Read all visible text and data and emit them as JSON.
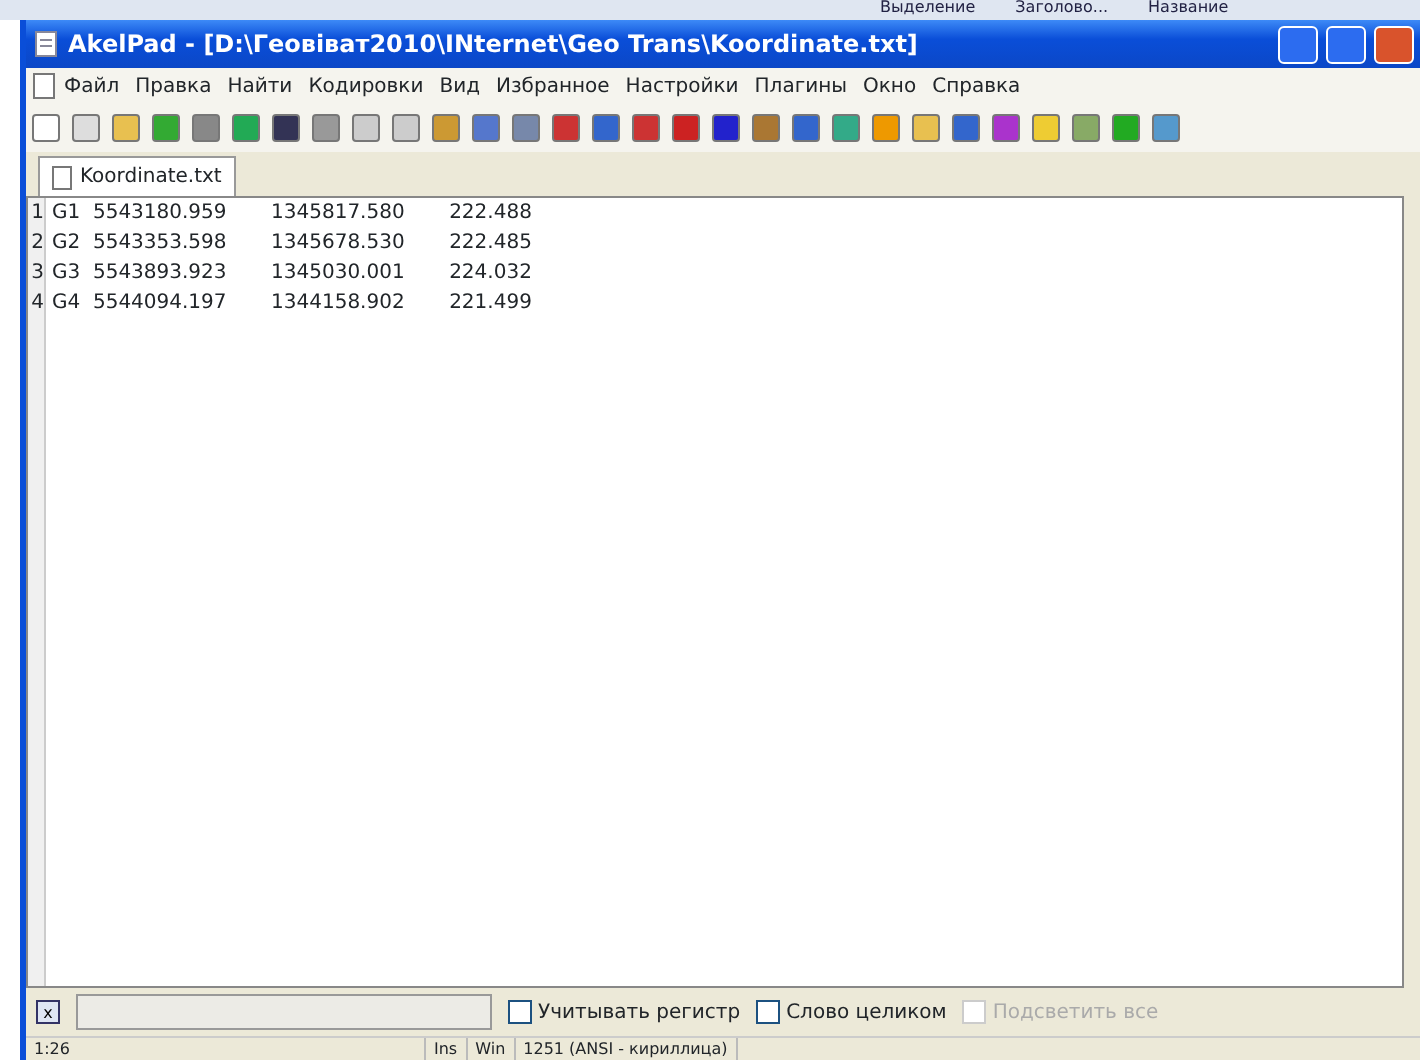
{
  "background_ribbon": [
    "Выделение",
    "Заголово...",
    "Название"
  ],
  "window": {
    "title": "AkelPad - [D:\\Геовіват2010\\INternet\\Geo Trans\\Koordinate.txt]"
  },
  "menu": [
    "Файл",
    "Правка",
    "Найти",
    "Кодировки",
    "Вид",
    "Избранное",
    "Настройки",
    "Плагины",
    "Окно",
    "Справка"
  ],
  "tabs": [
    {
      "label": "Koordinate.txt",
      "selected": true
    }
  ],
  "lines": [
    {
      "number": "1",
      "text": "G1  5543180.959       1345817.580       222.488"
    },
    {
      "number": "2",
      "text": "G2  5543353.598       1345678.530       222.485"
    },
    {
      "number": "3",
      "text": "G3  5543893.923       1345030.001       224.032"
    },
    {
      "number": "4",
      "text": "G4  5544094.197       1344158.902       221.499"
    }
  ],
  "find_bar": {
    "close": "x",
    "options": [
      {
        "label": "Учитывать регистр",
        "checked": false,
        "disabled": false
      },
      {
        "label": "Слово целиком",
        "checked": false,
        "disabled": false
      },
      {
        "label": "Подсветить все",
        "checked": false,
        "disabled": true
      }
    ]
  },
  "status_bar": [
    "1:26",
    "Ins",
    "Win",
    "1251  (ANSI - кириллица)"
  ]
}
